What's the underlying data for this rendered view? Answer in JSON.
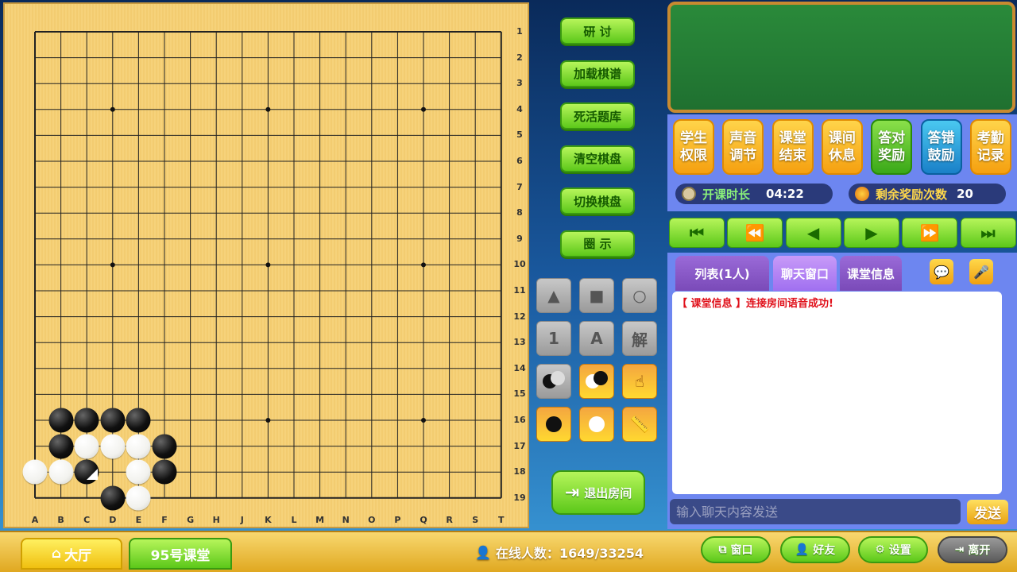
{
  "board": {
    "size": 19,
    "columns": [
      "A",
      "B",
      "C",
      "D",
      "E",
      "F",
      "G",
      "H",
      "J",
      "K",
      "L",
      "M",
      "N",
      "O",
      "P",
      "Q",
      "R",
      "S",
      "T"
    ],
    "rows": [
      "1",
      "2",
      "3",
      "4",
      "5",
      "6",
      "7",
      "8",
      "9",
      "10",
      "11",
      "12",
      "13",
      "14",
      "15",
      "16",
      "17",
      "18",
      "19"
    ],
    "star_points": [
      "D4",
      "K4",
      "Q4",
      "D10",
      "K10",
      "Q10",
      "D16",
      "K16",
      "Q16"
    ],
    "stones": [
      {
        "pos": "B16",
        "color": "black"
      },
      {
        "pos": "C16",
        "color": "black"
      },
      {
        "pos": "D16",
        "color": "black"
      },
      {
        "pos": "E16",
        "color": "black"
      },
      {
        "pos": "B17",
        "color": "black"
      },
      {
        "pos": "C17",
        "color": "white"
      },
      {
        "pos": "D17",
        "color": "white"
      },
      {
        "pos": "E17",
        "color": "white"
      },
      {
        "pos": "F17",
        "color": "black"
      },
      {
        "pos": "A18",
        "color": "white"
      },
      {
        "pos": "B18",
        "color": "white"
      },
      {
        "pos": "C18",
        "color": "black",
        "last_move": true
      },
      {
        "pos": "E18",
        "color": "white"
      },
      {
        "pos": "F18",
        "color": "black"
      },
      {
        "pos": "D19",
        "color": "black"
      },
      {
        "pos": "E19",
        "color": "white"
      }
    ]
  },
  "side_buttons": [
    "研 讨",
    "加载棋谱",
    "死活题库",
    "清空棋盘",
    "切换棋盘",
    "圈 示"
  ],
  "tools": [
    {
      "name": "triangle-icon",
      "glyph": "▲",
      "style": "grey"
    },
    {
      "name": "square-icon",
      "glyph": "■",
      "style": "grey"
    },
    {
      "name": "circle-icon",
      "glyph": "○",
      "style": "grey"
    },
    {
      "name": "number-1-icon",
      "glyph": "1",
      "style": "grey"
    },
    {
      "name": "letter-a-icon",
      "glyph": "A",
      "style": "grey"
    },
    {
      "name": "solve-icon",
      "glyph": "解",
      "style": "grey"
    },
    {
      "name": "alternate-black-first-icon",
      "glyph": "",
      "style": "grey"
    },
    {
      "name": "alternate-white-first-icon",
      "glyph": "",
      "style": "orange"
    },
    {
      "name": "hand-5-icon",
      "glyph": "☝",
      "style": "orange"
    },
    {
      "name": "black-stone-icon",
      "glyph": "",
      "style": "orange"
    },
    {
      "name": "white-stone-icon",
      "glyph": "",
      "style": "orange"
    },
    {
      "name": "ruler-icon",
      "glyph": "📏",
      "style": "orange"
    }
  ],
  "exit_room": "退出房间",
  "function_buttons": [
    {
      "label": "学生\n权限",
      "style": "yellow"
    },
    {
      "label": "声音\n调节",
      "style": "yellow"
    },
    {
      "label": "课堂\n结束",
      "style": "yellow"
    },
    {
      "label": "课间\n休息",
      "style": "yellow"
    },
    {
      "label": "答对\n奖励",
      "style": "green"
    },
    {
      "label": "答错\n鼓励",
      "style": "blue"
    },
    {
      "label": "考勤\n记录",
      "style": "yellow"
    }
  ],
  "class_time": {
    "label": "开课时长",
    "value": "04:22"
  },
  "rewards": {
    "label": "剩余奖励次数",
    "value": "20"
  },
  "playback": [
    "⏮",
    "⏪",
    "◀",
    "▶",
    "⏩",
    "⏭"
  ],
  "tabs": [
    {
      "label": "列表(1人)"
    },
    {
      "label": "聊天窗口",
      "active": true
    },
    {
      "label": "课堂信息"
    }
  ],
  "chat": {
    "messages": [
      "【 课堂信息 】连接房间语音成功!"
    ],
    "input_placeholder": "输入聊天内容发送",
    "send": "发送"
  },
  "bottom": {
    "hall": "大厅",
    "room": "95号课堂",
    "online_label": "在线人数：",
    "online_value": "1649/33254",
    "buttons": [
      "窗口",
      "好友",
      "设置",
      "离开"
    ]
  },
  "colors": {
    "accent_green": "#5cc81a",
    "chat_alert": "#e0101a",
    "panel": "#6d86f0"
  }
}
